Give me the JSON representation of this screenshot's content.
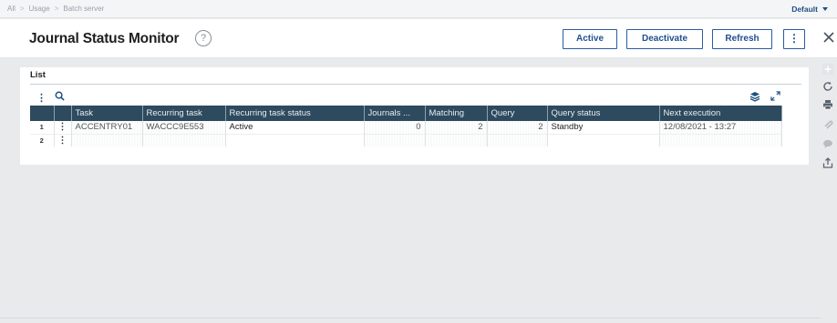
{
  "breadcrumb": [
    "All",
    "Usage",
    "Batch server"
  ],
  "folder": "Default",
  "page_title": "Journal Status Monitor",
  "actions": {
    "active": "Active",
    "deactivate": "Deactivate",
    "refresh": "Refresh"
  },
  "panel": {
    "title": "List"
  },
  "table": {
    "columns": [
      "Task",
      "Recurring task",
      "Recurring task status",
      "Journals ...",
      "Matching",
      "Query",
      "Query status",
      "Next execution"
    ],
    "rows": [
      {
        "row_number": "1",
        "task": "ACCENTRY01",
        "recurring_task": "WACCC9E553",
        "recurring_task_status": "Active",
        "journals": "0",
        "matching": "2",
        "query": "2",
        "query_status": "Standby",
        "next_execution": "12/08/2021 - 13:27"
      },
      {
        "row_number": "2",
        "task": "",
        "recurring_task": "",
        "recurring_task_status": "",
        "journals": "",
        "matching": "",
        "query": "",
        "query_status": "",
        "next_execution": ""
      }
    ]
  },
  "colors": {
    "accent": "#2a5ba0",
    "grid_header": "#2e4a5e"
  },
  "icons": [
    "help-icon",
    "close-icon",
    "kebab-icon",
    "search-icon",
    "layers-icon",
    "expand-icon",
    "plus-icon",
    "reload-icon",
    "print-icon",
    "clip-icon",
    "comment-icon",
    "export-icon"
  ]
}
